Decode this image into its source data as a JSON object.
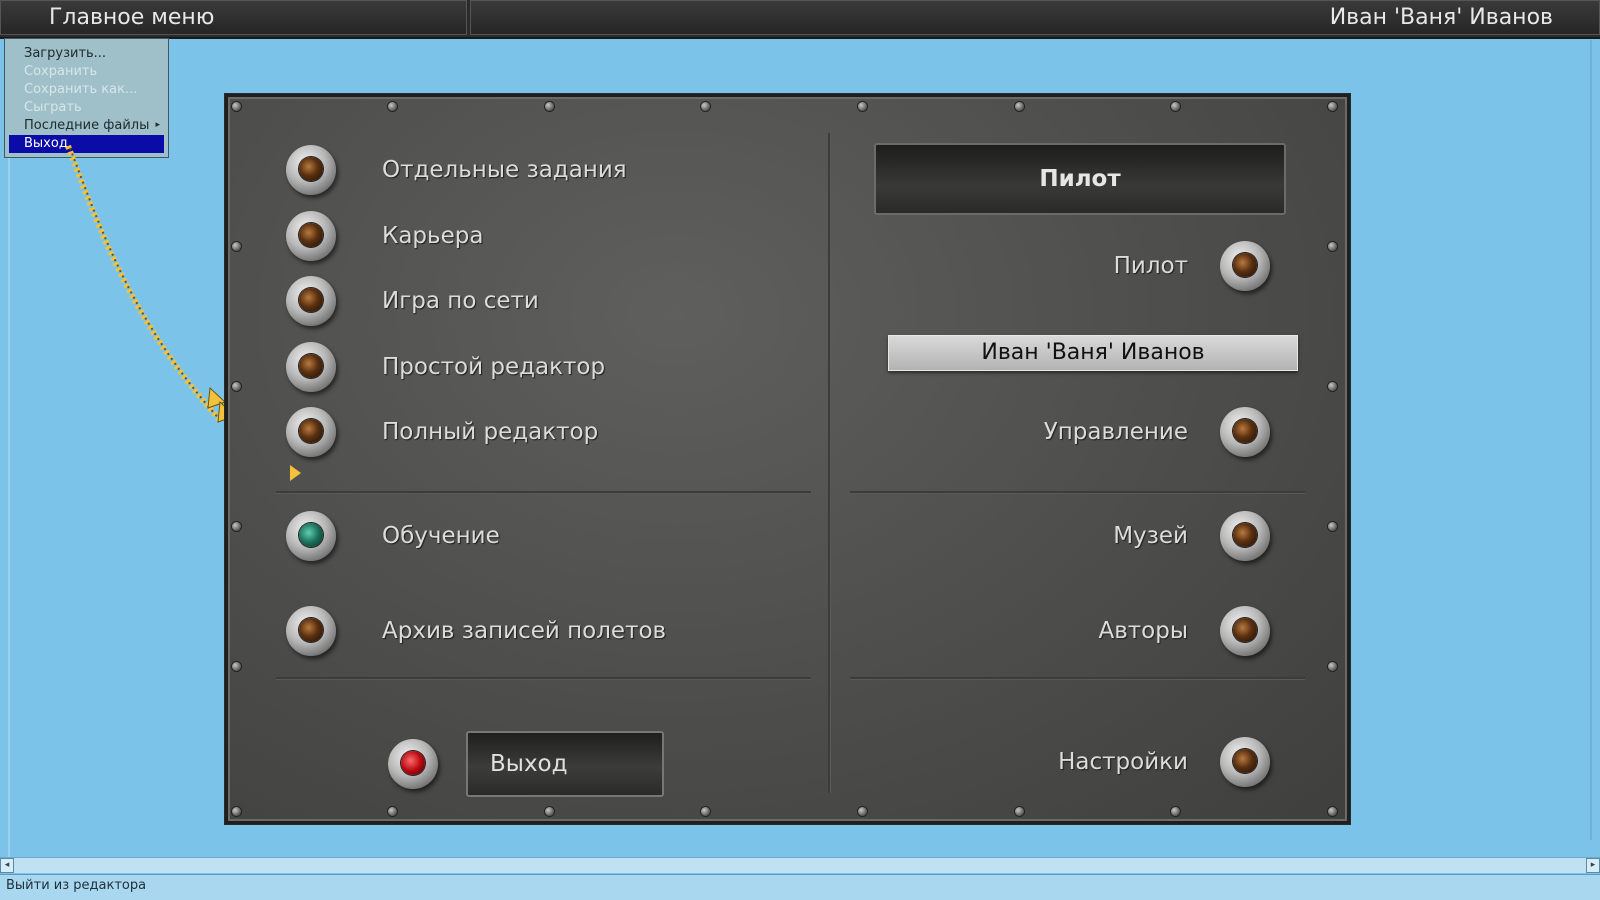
{
  "topbar": {
    "menu_title": "Главное меню",
    "user_name": "Иван 'Ваня' Иванов"
  },
  "menu": {
    "items": [
      {
        "label": "Загрузить...",
        "state": "enabled"
      },
      {
        "label": "Сохранить",
        "state": "disabled"
      },
      {
        "label": "Сохранить как...",
        "state": "disabled"
      },
      {
        "label": "Сыграть",
        "state": "disabled"
      },
      {
        "label": "Последние файлы",
        "state": "enabled",
        "submenu": true
      },
      {
        "label": "Выход",
        "state": "selected"
      }
    ],
    "submenu_arrow": "▸"
  },
  "main": {
    "left_items": [
      {
        "label": "Отдельные задания",
        "lamp": "amber"
      },
      {
        "label": "Карьера",
        "lamp": "amber"
      },
      {
        "label": "Игра по сети",
        "lamp": "amber"
      },
      {
        "label": "Простой редактор",
        "lamp": "amber"
      },
      {
        "label": "Полный редактор",
        "lamp": "amber"
      },
      {
        "label": "Обучение",
        "lamp": "teal"
      },
      {
        "label": "Архив записей полетов",
        "lamp": "amber"
      }
    ],
    "exit_label": "Выход",
    "pilot_header": "Пилот",
    "pilot_label": "Пилот",
    "pilot_name": "Иван 'Ваня' Иванов",
    "right_items": [
      {
        "label": "Управление"
      },
      {
        "label": "Музей"
      },
      {
        "label": "Авторы"
      },
      {
        "label": "Настройки"
      }
    ]
  },
  "statusbar": {
    "text": "Выйти из редактора"
  },
  "colors": {
    "desktop": "#7cc3ea",
    "panel": "#4d4d4b",
    "menu_bg": "#9fc0c8",
    "menu_selected": "#0b0ba8",
    "lamp_teal": "#1a6e5a",
    "lamp_red": "#b80a10"
  }
}
